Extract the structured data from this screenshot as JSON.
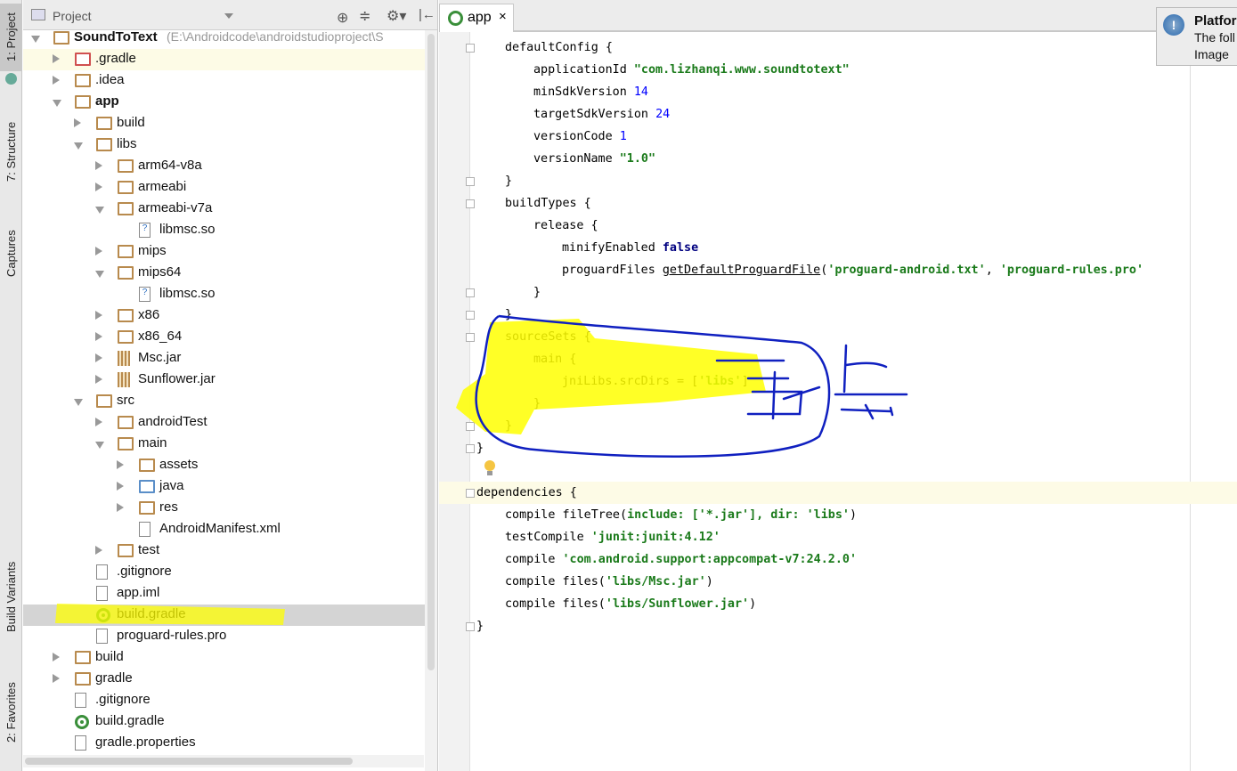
{
  "tool_strip": {
    "project": "1: Project",
    "structure": "7: Structure",
    "captures": "Captures",
    "build_variants": "Build Variants",
    "favorites": "2: Favorites"
  },
  "project_panel": {
    "title": "Project",
    "icons": [
      "locate-icon",
      "collapse-icon",
      "gear-icon",
      "hide-icon"
    ]
  },
  "tree": [
    {
      "label": "SoundToText",
      "hint": " (E:\\Androidcode\\androidstudioproject\\S",
      "depth": 0,
      "state": "e",
      "icon": "module",
      "bold": true
    },
    {
      "label": ".gradle",
      "depth": 1,
      "state": "c",
      "icon": "folder-red"
    },
    {
      "label": ".idea",
      "depth": 1,
      "state": "c",
      "icon": "folder"
    },
    {
      "label": "app",
      "depth": 1,
      "state": "e",
      "icon": "module",
      "bold": true
    },
    {
      "label": "build",
      "depth": 2,
      "state": "c",
      "icon": "folder"
    },
    {
      "label": "libs",
      "depth": 2,
      "state": "e",
      "icon": "folder"
    },
    {
      "label": "arm64-v8a",
      "depth": 3,
      "state": "c",
      "icon": "folder"
    },
    {
      "label": "armeabi",
      "depth": 3,
      "state": "c",
      "icon": "folder"
    },
    {
      "label": "armeabi-v7a",
      "depth": 3,
      "state": "e",
      "icon": "folder"
    },
    {
      "label": "libmsc.so",
      "depth": 4,
      "state": "",
      "icon": "file"
    },
    {
      "label": "mips",
      "depth": 3,
      "state": "c",
      "icon": "folder"
    },
    {
      "label": "mips64",
      "depth": 3,
      "state": "e",
      "icon": "folder"
    },
    {
      "label": "libmsc.so",
      "depth": 4,
      "state": "",
      "icon": "file"
    },
    {
      "label": "x86",
      "depth": 3,
      "state": "c",
      "icon": "folder"
    },
    {
      "label": "x86_64",
      "depth": 3,
      "state": "c",
      "icon": "folder"
    },
    {
      "label": "Msc.jar",
      "depth": 3,
      "state": "c",
      "icon": "jar"
    },
    {
      "label": "Sunflower.jar",
      "depth": 3,
      "state": "c",
      "icon": "jar"
    },
    {
      "label": "src",
      "depth": 2,
      "state": "e",
      "icon": "folder"
    },
    {
      "label": "androidTest",
      "depth": 3,
      "state": "c",
      "icon": "folder"
    },
    {
      "label": "main",
      "depth": 3,
      "state": "e",
      "icon": "folder"
    },
    {
      "label": "assets",
      "depth": 4,
      "state": "c",
      "icon": "folder"
    },
    {
      "label": "java",
      "depth": 4,
      "state": "c",
      "icon": "folder-blue"
    },
    {
      "label": "res",
      "depth": 4,
      "state": "c",
      "icon": "folder"
    },
    {
      "label": "AndroidManifest.xml",
      "depth": 4,
      "state": "",
      "icon": "xml"
    },
    {
      "label": "test",
      "depth": 3,
      "state": "c",
      "icon": "folder"
    },
    {
      "label": ".gitignore",
      "depth": 2,
      "state": "",
      "icon": "text"
    },
    {
      "label": "app.iml",
      "depth": 2,
      "state": "",
      "icon": "text"
    },
    {
      "label": "build.gradle",
      "depth": 2,
      "state": "",
      "icon": "gradle",
      "selected": true
    },
    {
      "label": "proguard-rules.pro",
      "depth": 2,
      "state": "",
      "icon": "text"
    },
    {
      "label": "build",
      "depth": 1,
      "state": "c",
      "icon": "folder"
    },
    {
      "label": "gradle",
      "depth": 1,
      "state": "c",
      "icon": "folder"
    },
    {
      "label": ".gitignore",
      "depth": 1,
      "state": "",
      "icon": "text"
    },
    {
      "label": "build.gradle",
      "depth": 1,
      "state": "",
      "icon": "gradle"
    },
    {
      "label": "gradle.properties",
      "depth": 1,
      "state": "",
      "icon": "props"
    }
  ],
  "editor": {
    "tab": "app",
    "close": "×"
  },
  "code": [
    {
      "i": 1,
      "f": 1,
      "s": [
        [
          "defaultConfig {",
          ""
        ]
      ]
    },
    {
      "i": 2,
      "s": [
        [
          "applicationId ",
          ""
        ],
        [
          "\"com.lizhanqi.www.soundtotext\"",
          "s"
        ]
      ]
    },
    {
      "i": 2,
      "s": [
        [
          "minSdkVersion ",
          ""
        ],
        [
          "14",
          "n"
        ]
      ]
    },
    {
      "i": 2,
      "s": [
        [
          "targetSdkVersion ",
          ""
        ],
        [
          "24",
          "n"
        ]
      ]
    },
    {
      "i": 2,
      "s": [
        [
          "versionCode ",
          ""
        ],
        [
          "1",
          "n"
        ]
      ]
    },
    {
      "i": 2,
      "s": [
        [
          "versionName ",
          ""
        ],
        [
          "\"1.0\"",
          "s"
        ]
      ]
    },
    {
      "i": 1,
      "f": 1,
      "s": [
        [
          "}",
          ""
        ]
      ]
    },
    {
      "i": 1,
      "f": 1,
      "s": [
        [
          "buildTypes {",
          ""
        ]
      ]
    },
    {
      "i": 2,
      "s": [
        [
          "release {",
          ""
        ]
      ]
    },
    {
      "i": 3,
      "s": [
        [
          "minifyEnabled ",
          ""
        ],
        [
          "false",
          "k"
        ]
      ]
    },
    {
      "i": 3,
      "s": [
        [
          "proguardFiles ",
          ""
        ],
        [
          "getDefaultProguardFile",
          "u"
        ],
        [
          "(",
          ""
        ],
        [
          "'proguard-android.txt'",
          "s"
        ],
        [
          ", ",
          ""
        ],
        [
          "'proguard-rules.pro'",
          "s"
        ]
      ]
    },
    {
      "i": 2,
      "f": 1,
      "s": [
        [
          "}",
          ""
        ]
      ]
    },
    {
      "i": 1,
      "f": 1,
      "s": [
        [
          "}",
          ""
        ]
      ]
    },
    {
      "i": 1,
      "f": 1,
      "s": [
        [
          "sourceSets {",
          ""
        ]
      ]
    },
    {
      "i": 2,
      "s": [
        [
          "main {",
          ""
        ]
      ]
    },
    {
      "i": 3,
      "s": [
        [
          "jniLibs.srcDirs = [",
          ""
        ],
        [
          "'libs'",
          "s"
        ],
        [
          "]",
          ""
        ]
      ]
    },
    {
      "i": 2,
      "s": [
        [
          "}",
          ""
        ]
      ]
    },
    {
      "i": 1,
      "f": 1,
      "s": [
        [
          "}",
          ""
        ]
      ]
    },
    {
      "i": 0,
      "f": 1,
      "s": [
        [
          "}",
          ""
        ]
      ]
    },
    {
      "i": 0,
      "s": []
    },
    {
      "i": 0,
      "f": 1,
      "hl": true,
      "s": [
        [
          "dependencies {",
          ""
        ]
      ]
    },
    {
      "i": 1,
      "s": [
        [
          "compile fileTree(",
          ""
        ],
        [
          "include: ['*.jar'], dir: 'libs'",
          "s"
        ],
        [
          ")",
          ""
        ]
      ]
    },
    {
      "i": 1,
      "s": [
        [
          "testCompile ",
          ""
        ],
        [
          "'junit:junit:4.12'",
          "s"
        ]
      ]
    },
    {
      "i": 1,
      "s": [
        [
          "compile ",
          ""
        ],
        [
          "'com.android.support:appcompat-v7:24.2.0'",
          "s"
        ]
      ]
    },
    {
      "i": 1,
      "s": [
        [
          "compile files(",
          ""
        ],
        [
          "'libs/Msc.jar'",
          "s"
        ],
        [
          ")",
          ""
        ]
      ]
    },
    {
      "i": 1,
      "s": [
        [
          "compile files(",
          ""
        ],
        [
          "'libs/Sunflower.jar'",
          "s"
        ],
        [
          ")",
          ""
        ]
      ]
    },
    {
      "i": 0,
      "f": 1,
      "s": [
        [
          "}",
          ""
        ]
      ]
    }
  ],
  "notification": {
    "title": "Platfor",
    "line1": "The foll",
    "line2": "Image"
  },
  "colors": {
    "highlight": "#ffff00",
    "ink": "#1020c0",
    "string": "#1a7a1a",
    "number": "#0000ff",
    "keyword": "#000080"
  }
}
